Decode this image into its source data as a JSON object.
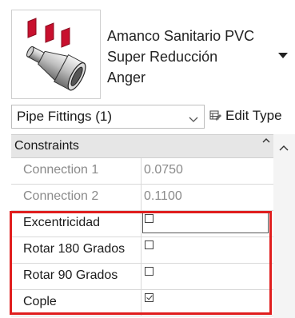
{
  "type_selector": {
    "name_lines": [
      "Amanco Sanitario PVC",
      "Super Reducción",
      "Anger"
    ],
    "preview_icon": "pipe-reducer-fitting-icon",
    "dropdown_icon": "triangle-down-icon"
  },
  "instance_selector": {
    "label": "Pipe Fittings (1)",
    "caret_icon": "chevron-down-icon"
  },
  "edit_type": {
    "label": "Edit Type",
    "icon": "edit-type-icon"
  },
  "properties": {
    "group": "Constraints",
    "collapse_icon": "collapse-caret-icon",
    "rows": [
      {
        "name": "Connection 1",
        "value": "0.0750",
        "kind": "text",
        "readonly": true
      },
      {
        "name": "Connection 2",
        "value": "0.1100",
        "kind": "text",
        "readonly": true
      },
      {
        "name": "Excentricidad",
        "value": false,
        "kind": "checkbox",
        "readonly": false
      },
      {
        "name": "Rotar 180 Grados",
        "value": false,
        "kind": "checkbox",
        "readonly": false
      },
      {
        "name": "Rotar 90 Grados",
        "value": false,
        "kind": "checkbox",
        "readonly": false
      },
      {
        "name": "Cople",
        "value": true,
        "kind": "checkbox",
        "readonly": false
      }
    ]
  },
  "colors": {
    "highlight": "#e01e1e",
    "fitting_red": "#c8102e",
    "group_header_bg": "#e6e6e6",
    "readonly_text": "#8a8a8a"
  }
}
